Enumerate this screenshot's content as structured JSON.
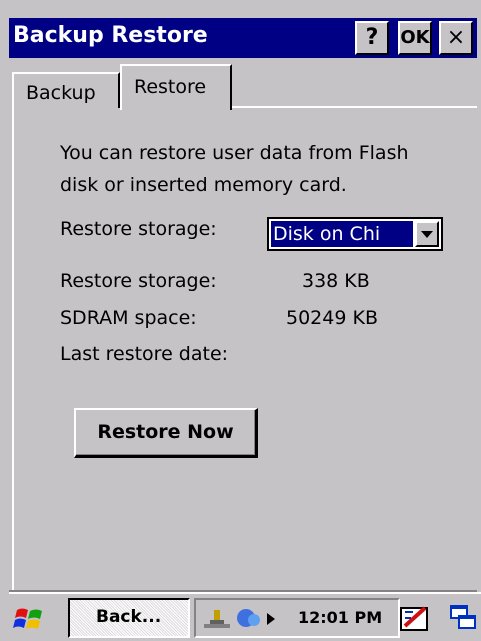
{
  "window": {
    "title": "Backup Restore",
    "help_label": "?",
    "ok_label": "OK",
    "close_label": "×"
  },
  "tabs": [
    {
      "label": "Backup",
      "active": false
    },
    {
      "label": "Restore",
      "active": true
    }
  ],
  "restore": {
    "description_line1": "You can restore user data from Flash",
    "description_line2": "disk or inserted memory card.",
    "storage_label": "Restore storage:",
    "storage_selected": "Disk on Chi",
    "info": [
      {
        "label": "Restore storage:",
        "value": "338 KB"
      },
      {
        "label": "SDRAM space:",
        "value": "50249 KB"
      },
      {
        "label": "Last restore date:",
        "value": ""
      }
    ],
    "restore_button": "Restore Now"
  },
  "taskbar": {
    "task_label": "Back...",
    "clock": "12:01 PM",
    "icons": [
      "start-flag-icon",
      "network-icon",
      "connection-icon",
      "tray-arrow-icon",
      "input-panel-icon",
      "desktop-icon"
    ]
  },
  "colors": {
    "titlebar": "#000084",
    "face": "#c6c3c6",
    "selection": "#000084"
  }
}
